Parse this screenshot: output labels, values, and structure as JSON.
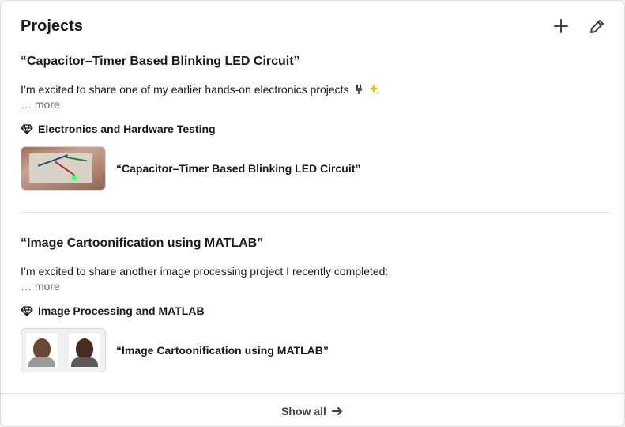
{
  "section": {
    "title": "Projects",
    "add_icon": "plus-icon",
    "edit_icon": "pencil-icon"
  },
  "projects": [
    {
      "title": "“Capacitor–Timer Based Blinking LED Circuit”",
      "description": "I’m excited to share one of my earlier hands-on electronics projects",
      "emojis": [
        "plug-icon",
        "sparkles-icon"
      ],
      "more": "… more",
      "skill": "Electronics and Hardware Testing",
      "media_title": "“Capacitor–Timer Based Blinking LED Circuit”"
    },
    {
      "title": "“Image Cartoonification using MATLAB”",
      "description": "I’m excited to share another image processing project I recently completed:",
      "more": "… more",
      "skill": "Image Processing and MATLAB",
      "media_title": "“Image Cartoonification using MATLAB”"
    }
  ],
  "footer": {
    "show_all": "Show all"
  }
}
